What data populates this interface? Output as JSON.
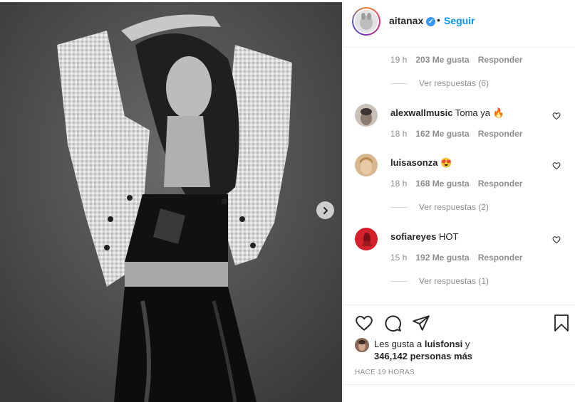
{
  "post": {
    "username": "aitanax",
    "follow_label": "Seguir",
    "dot": "•",
    "verified_glyph": "✓"
  },
  "comments": {
    "top_meta": {
      "time": "19 h",
      "likes": "203 Me gusta",
      "reply": "Responder"
    },
    "top_replies": "Ver respuestas (6)",
    "items": [
      {
        "user": "alexwallmusic",
        "text": "Toma ya 🔥",
        "time": "18 h",
        "likes": "162 Me gusta",
        "reply": "Responder",
        "replies": ""
      },
      {
        "user": "luisasonza",
        "text": "😍",
        "time": "18 h",
        "likes": "168 Me gusta",
        "reply": "Responder",
        "replies": "Ver respuestas (2)"
      },
      {
        "user": "sofiareyes",
        "text": "HOT",
        "time": "15 h",
        "likes": "192 Me gusta",
        "reply": "Responder",
        "replies": "Ver respuestas (1)"
      }
    ]
  },
  "actions": {
    "likes_prefix": "Les gusta a",
    "likes_user": "luisfonsi",
    "likes_suffix": "y",
    "likes_count": "346,142 personas más",
    "time_ago": "HACE 19 HORAS"
  },
  "icons": {
    "next": "chevron-right-icon",
    "like": "heart-icon",
    "comment": "comment-icon",
    "share": "share-icon",
    "save": "bookmark-icon"
  },
  "colors": {
    "accent": "#0095f6",
    "verified": "#3897f0",
    "muted": "#8e8e8e",
    "text": "#262626"
  }
}
